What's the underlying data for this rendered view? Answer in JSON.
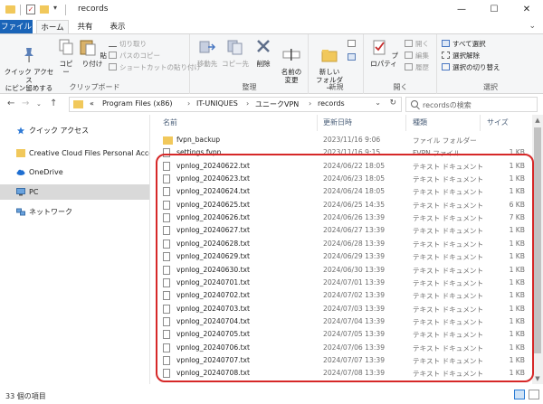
{
  "window": {
    "title": "records",
    "controls": {
      "minimize": "—",
      "maximize": "☐",
      "close": "✕"
    }
  },
  "ribbon_tabs": [
    "ファイル",
    "ホーム",
    "共有",
    "表示"
  ],
  "ribbon": {
    "clipboard": {
      "pin_label": "クイック アクセス\nにピン留めする",
      "copy_label": "コピー",
      "paste_label": "貼り付け",
      "cut_label": "切り取り",
      "copy_path_label": "パスのコピー",
      "paste_shortcut_label": "ショートカットの貼り付け",
      "group_label": "クリップボード"
    },
    "organize": {
      "move_label": "移動先",
      "copyto_label": "コピー先",
      "delete_label": "削除",
      "rename_label": "名前の\n変更",
      "group_label": "整理"
    },
    "new": {
      "new_folder_label": "新しい\nフォルダー",
      "group_label": "新規"
    },
    "open": {
      "properties_label": "プロパティ",
      "open_label": "開く",
      "edit_label": "編集",
      "history_label": "履歴",
      "group_label": "開く"
    },
    "select": {
      "select_all_label": "すべて選択",
      "select_none_label": "選択解除",
      "invert_label": "選択の切り替え",
      "group_label": "選択"
    }
  },
  "address": {
    "segments": [
      "«",
      "Program Files (x86)",
      "IT-UNIQUES",
      "ユニークVPN",
      "records"
    ],
    "search_placeholder": "recordsの検索"
  },
  "nav_pane": [
    {
      "label": "クイック アクセス",
      "icon": "star-icon"
    },
    {
      "label": "Creative Cloud Files Personal Account",
      "icon": "folder-icon"
    },
    {
      "label": "OneDrive",
      "icon": "cloud-icon"
    },
    {
      "label": "PC",
      "icon": "pc-icon",
      "selected": true
    },
    {
      "label": "ネットワーク",
      "icon": "network-icon"
    }
  ],
  "columns": {
    "name": "名前",
    "date": "更新日時",
    "type": "種類",
    "size": "サイズ"
  },
  "files": [
    {
      "name": "fvpn_backup",
      "date": "2023/11/16 9:06",
      "type": "ファイル フォルダー",
      "size": "",
      "kind": "folder"
    },
    {
      "name": "settings.fvpn",
      "date": "2023/11/16 9:15",
      "type": "FVPN ファイル",
      "size": "1 KB",
      "kind": "file"
    },
    {
      "name": "vpnlog_20240622.txt",
      "date": "2024/06/22 18:05",
      "type": "テキスト ドキュメント",
      "size": "1 KB",
      "kind": "file"
    },
    {
      "name": "vpnlog_20240623.txt",
      "date": "2024/06/23 18:05",
      "type": "テキスト ドキュメント",
      "size": "1 KB",
      "kind": "file"
    },
    {
      "name": "vpnlog_20240624.txt",
      "date": "2024/06/24 18:05",
      "type": "テキスト ドキュメント",
      "size": "1 KB",
      "kind": "file"
    },
    {
      "name": "vpnlog_20240625.txt",
      "date": "2024/06/25 14:35",
      "type": "テキスト ドキュメント",
      "size": "6 KB",
      "kind": "file"
    },
    {
      "name": "vpnlog_20240626.txt",
      "date": "2024/06/26 13:39",
      "type": "テキスト ドキュメント",
      "size": "7 KB",
      "kind": "file"
    },
    {
      "name": "vpnlog_20240627.txt",
      "date": "2024/06/27 13:39",
      "type": "テキスト ドキュメント",
      "size": "1 KB",
      "kind": "file"
    },
    {
      "name": "vpnlog_20240628.txt",
      "date": "2024/06/28 13:39",
      "type": "テキスト ドキュメント",
      "size": "1 KB",
      "kind": "file"
    },
    {
      "name": "vpnlog_20240629.txt",
      "date": "2024/06/29 13:39",
      "type": "テキスト ドキュメント",
      "size": "1 KB",
      "kind": "file"
    },
    {
      "name": "vpnlog_20240630.txt",
      "date": "2024/06/30 13:39",
      "type": "テキスト ドキュメント",
      "size": "1 KB",
      "kind": "file"
    },
    {
      "name": "vpnlog_20240701.txt",
      "date": "2024/07/01 13:39",
      "type": "テキスト ドキュメント",
      "size": "1 KB",
      "kind": "file"
    },
    {
      "name": "vpnlog_20240702.txt",
      "date": "2024/07/02 13:39",
      "type": "テキスト ドキュメント",
      "size": "1 KB",
      "kind": "file"
    },
    {
      "name": "vpnlog_20240703.txt",
      "date": "2024/07/03 13:39",
      "type": "テキスト ドキュメント",
      "size": "1 KB",
      "kind": "file"
    },
    {
      "name": "vpnlog_20240704.txt",
      "date": "2024/07/04 13:39",
      "type": "テキスト ドキュメント",
      "size": "1 KB",
      "kind": "file"
    },
    {
      "name": "vpnlog_20240705.txt",
      "date": "2024/07/05 13:39",
      "type": "テキスト ドキュメント",
      "size": "1 KB",
      "kind": "file"
    },
    {
      "name": "vpnlog_20240706.txt",
      "date": "2024/07/06 13:39",
      "type": "テキスト ドキュメント",
      "size": "1 KB",
      "kind": "file"
    },
    {
      "name": "vpnlog_20240707.txt",
      "date": "2024/07/07 13:39",
      "type": "テキスト ドキュメント",
      "size": "1 KB",
      "kind": "file"
    },
    {
      "name": "vpnlog_20240708.txt",
      "date": "2024/07/08 13:39",
      "type": "テキスト ドキュメント",
      "size": "1 KB",
      "kind": "file"
    }
  ],
  "status": {
    "item_count": "33 個の項目"
  },
  "colors": {
    "accent": "#1a64b8",
    "highlight": "#d62828",
    "folder": "#f1c85b"
  }
}
